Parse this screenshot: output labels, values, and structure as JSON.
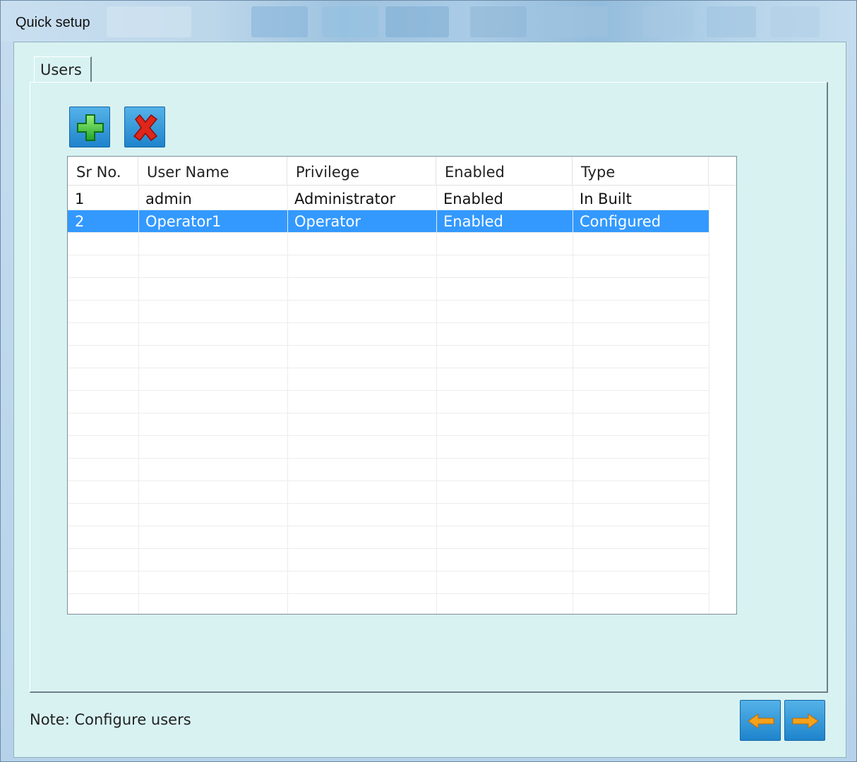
{
  "window": {
    "title": "Quick setup"
  },
  "tabs": [
    {
      "label": "Users",
      "active": true
    }
  ],
  "toolbar": {
    "add_icon": "plus-icon",
    "delete_icon": "red-x-icon"
  },
  "users_table": {
    "columns": [
      "Sr No.",
      "User Name",
      "Privilege",
      "Enabled",
      "Type"
    ],
    "rows": [
      [
        "1",
        "admin",
        "Administrator",
        "Enabled",
        "In Built"
      ],
      [
        "2",
        "Operator1",
        "Operator",
        "Enabled",
        "Configured"
      ]
    ],
    "selected_row": 2,
    "selection_color": "#3399ff"
  },
  "footer": {
    "note": "Note: Configure users",
    "back_icon": "arrow-left-icon",
    "next_icon": "arrow-right-icon"
  },
  "colors": {
    "panel_background": "#d8f2f2",
    "button_blue": "#2a8fd6",
    "arrow_orange": "#f7a21b",
    "add_green": "#2fc23a",
    "delete_red": "#e0251b"
  }
}
